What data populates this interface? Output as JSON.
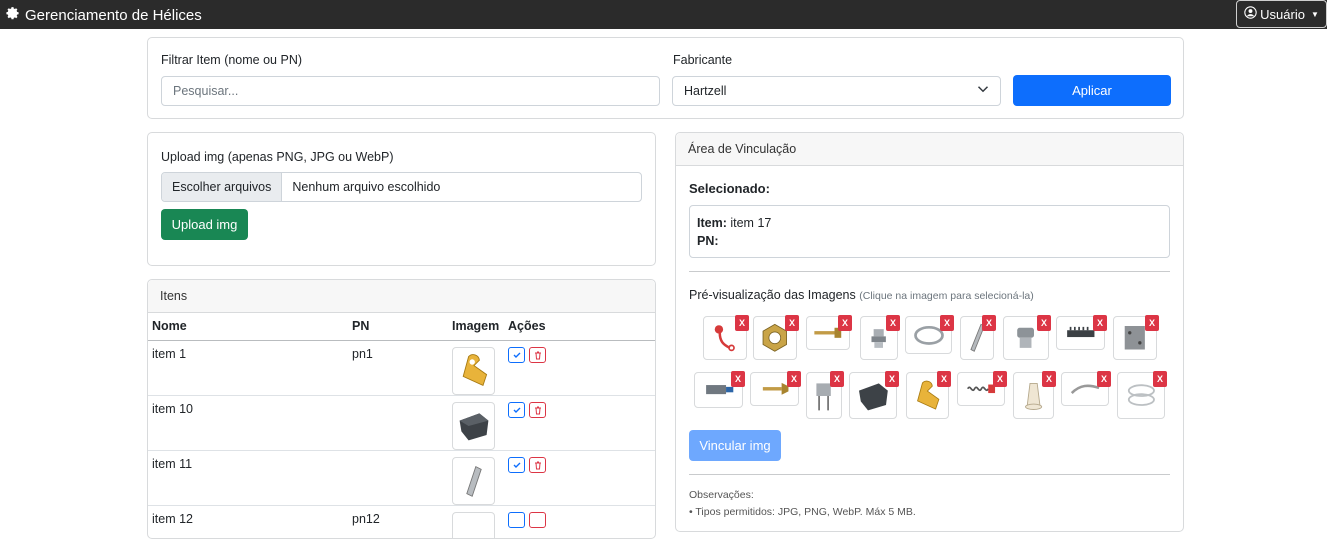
{
  "app": {
    "title": "Gerenciamento de Hélices",
    "user_label": "Usuário"
  },
  "filter": {
    "item_label": "Filtrar Item (nome ou PN)",
    "item_placeholder": "Pesquisar...",
    "maker_label": "Fabricante",
    "maker_value": "Hartzell",
    "apply_label": "Aplicar"
  },
  "upload": {
    "label": "Upload img (apenas PNG, JPG ou WebP)",
    "choose_label": "Escolher arquivos",
    "no_file_label": "Nenhum arquivo escolhido",
    "button_label": "Upload img"
  },
  "items": {
    "title": "Itens",
    "columns": [
      "Nome",
      "PN",
      "Imagem",
      "Ações"
    ],
    "rows": [
      {
        "name": "item 1",
        "pn": "pn1",
        "image_icon": "yellow-clip"
      },
      {
        "name": "item 10",
        "pn": "",
        "image_icon": "dark-block"
      },
      {
        "name": "item 11",
        "pn": "",
        "image_icon": "silver-pin"
      },
      {
        "name": "item 12",
        "pn": "pn12",
        "image_icon": "part"
      }
    ]
  },
  "link": {
    "title": "Área de Vinculação",
    "selected_label": "Selecionado:",
    "item_label": "Item:",
    "item_value": "item 17",
    "pn_label": "PN:",
    "pn_value": "",
    "preview_label": "Pré-visualização das Imagens",
    "preview_hint": "(Clique na imagem para selecioná-la)",
    "remove_label": "X",
    "link_button_label": "Vincular img",
    "notes_title": "Observações:",
    "notes_line1": "• Tipos permitidos: JPG, PNG, WebP. Máx 5 MB."
  },
  "colors": {
    "primary": "#0d6efd",
    "success": "#198754",
    "danger": "#dc3545",
    "navbar": "#2b2b2b"
  }
}
